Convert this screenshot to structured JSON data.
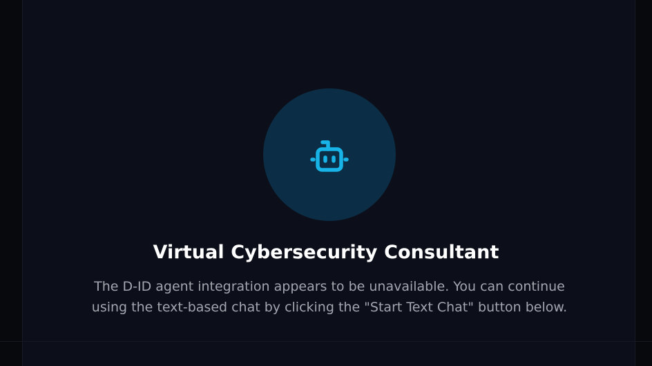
{
  "colors": {
    "background": "#08090c",
    "panel": "#0c0f19",
    "avatar_circle": "#0b2d45",
    "accent": "#18b4e8",
    "title_text": "#ffffff",
    "body_text": "#a3a6ae"
  },
  "avatar": {
    "icon": "robot-icon"
  },
  "title": "Virtual Cybersecurity Consultant",
  "description": "The D-ID agent integration appears to be unavailable. You can continue using the text-based chat by clicking the \"Start Text Chat\" button below."
}
